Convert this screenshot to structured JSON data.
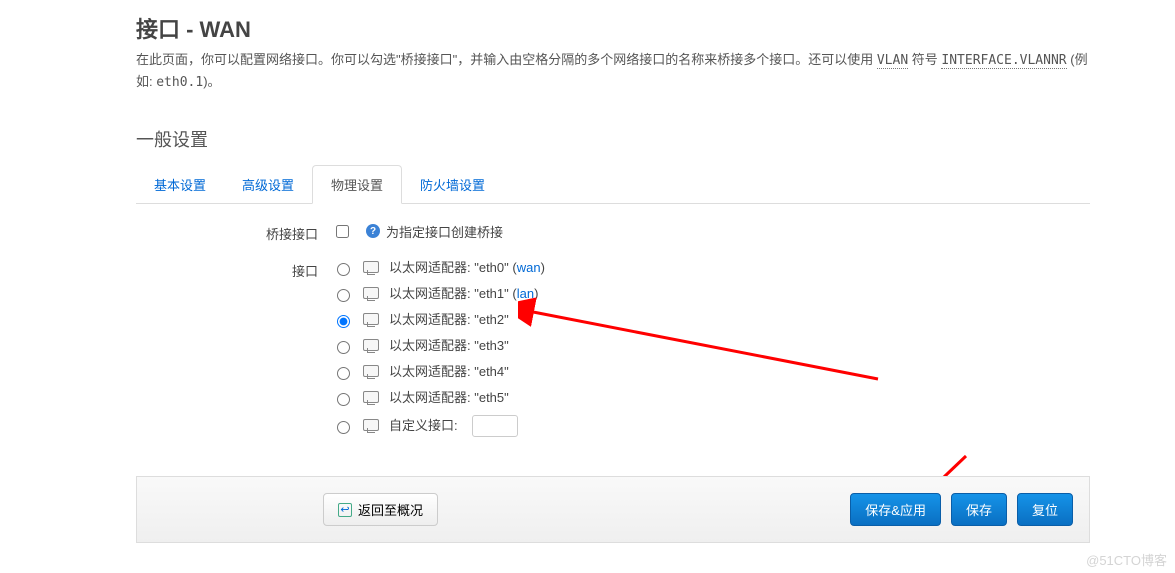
{
  "title": "接口 - WAN",
  "desc_prefix": "在此页面，你可以配置网络接口。你可以勾选\"桥接接口\"，并输入由空格分隔的多个网络接口的名称来桥接多个接口。还可以使用 ",
  "desc_vlan": "VLAN",
  "desc_mid": " 符号 ",
  "desc_intf": "INTERFACE.VLANNR",
  "desc_suffix": " (例如: ",
  "desc_eth": "eth0.1",
  "desc_end": ")。",
  "section_title": "一般设置",
  "tabs": {
    "basic": "基本设置",
    "advanced": "高级设置",
    "physical": "物理设置",
    "firewall": "防火墙设置"
  },
  "form": {
    "bridge_label": "桥接接口",
    "bridge_help": "为指定接口创建桥接",
    "iface_label": "接口",
    "adapters": [
      {
        "text_pre": "以太网适配器: \"eth0\" (",
        "tag": "wan",
        "text_post": ")"
      },
      {
        "text_pre": "以太网适配器: \"eth1\" (",
        "tag": "lan",
        "text_post": ")"
      },
      {
        "text_pre": "以太网适配器: \"eth2\"",
        "tag": "",
        "text_post": ""
      },
      {
        "text_pre": "以太网适配器: \"eth3\"",
        "tag": "",
        "text_post": ""
      },
      {
        "text_pre": "以太网适配器: \"eth4\"",
        "tag": "",
        "text_post": ""
      },
      {
        "text_pre": "以太网适配器: \"eth5\"",
        "tag": "",
        "text_post": ""
      }
    ],
    "custom_label": "自定义接口:"
  },
  "buttons": {
    "back": "返回至概况",
    "save_apply": "保存&应用",
    "save": "保存",
    "reset": "复位"
  },
  "watermark": "@51CTO博客"
}
